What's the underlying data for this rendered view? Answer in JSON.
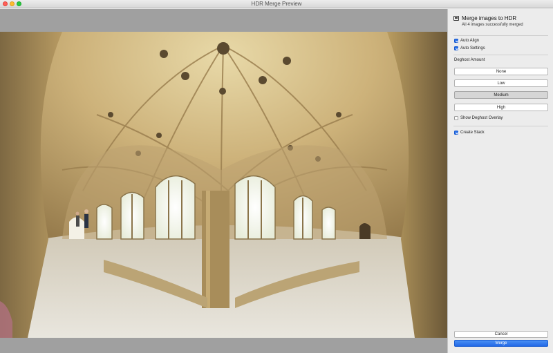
{
  "window": {
    "title": "HDR Merge Preview"
  },
  "panel": {
    "title": "Merge images to HDR",
    "subtitle": "All 4 images successfully merged",
    "auto_align": {
      "label": "Auto Align",
      "checked": true
    },
    "auto_settings": {
      "label": "Auto Settings",
      "checked": true
    },
    "deghost": {
      "label": "Deghost Amount",
      "options": [
        "None",
        "Low",
        "Medium",
        "High"
      ],
      "selected": "Medium"
    },
    "show_deghost_overlay": {
      "label": "Show Deghost Overlay",
      "checked": false
    },
    "create_stack": {
      "label": "Create Stack",
      "checked": true
    },
    "cancel_label": "Cancel",
    "merge_label": "Merge"
  },
  "colors": {
    "accent": "#2a72e8",
    "panel_bg": "#ececec",
    "preview_bg": "#a0a0a0"
  },
  "icons": {
    "window_close": "close-dot",
    "window_minimize": "minimize-dot",
    "window_maximize": "maximize-dot",
    "hdr_header": "stack-icon"
  }
}
